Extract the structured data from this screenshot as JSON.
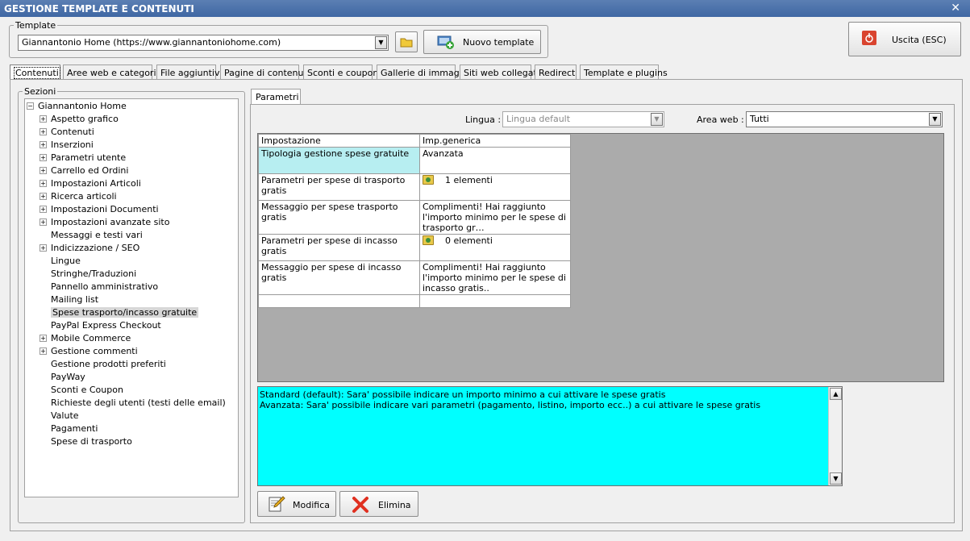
{
  "window": {
    "title": "GESTIONE TEMPLATE E CONTENUTI",
    "close_glyph": "✕"
  },
  "template": {
    "group_label": "Template",
    "selected": "Giannantonio Home (https://www.giannantoniohome.com)",
    "new_button": "Nuovo template"
  },
  "exit_button": "Uscita (ESC)",
  "tabs": [
    {
      "label": "Contenuti",
      "active": true
    },
    {
      "label": "Aree web e categorie"
    },
    {
      "label": "File aggiuntivi"
    },
    {
      "label": "Pagine di contenuti"
    },
    {
      "label": "Sconti e coupon"
    },
    {
      "label": "Gallerie di immagini"
    },
    {
      "label": "Siti web collegati"
    },
    {
      "label": "Redirect"
    },
    {
      "label": "Template e plugins"
    }
  ],
  "sections": {
    "label": "Sezioni",
    "root": "Giannantonio Home",
    "items": [
      {
        "label": "Aspetto grafico",
        "expandable": true
      },
      {
        "label": "Contenuti",
        "expandable": true
      },
      {
        "label": "Inserzioni",
        "expandable": true
      },
      {
        "label": "Parametri utente",
        "expandable": true
      },
      {
        "label": "Carrello ed Ordini",
        "expandable": true
      },
      {
        "label": "Impostazioni Articoli",
        "expandable": true
      },
      {
        "label": "Ricerca articoli",
        "expandable": true
      },
      {
        "label": "Impostazioni Documenti",
        "expandable": true
      },
      {
        "label": "Impostazioni avanzate sito",
        "expandable": true
      },
      {
        "label": "Messaggi e testi vari",
        "expandable": false
      },
      {
        "label": "Indicizzazione / SEO",
        "expandable": true
      },
      {
        "label": "Lingue",
        "expandable": false
      },
      {
        "label": "Stringhe/Traduzioni",
        "expandable": false
      },
      {
        "label": "Pannello amministrativo",
        "expandable": false
      },
      {
        "label": "Mailing list",
        "expandable": false
      },
      {
        "label": "Spese trasporto/incasso gratuite",
        "expandable": false,
        "selected": true
      },
      {
        "label": "PayPal Express Checkout",
        "expandable": false
      },
      {
        "label": "Mobile Commerce",
        "expandable": true
      },
      {
        "label": "Gestione commenti",
        "expandable": true
      },
      {
        "label": "Gestione prodotti preferiti",
        "expandable": false
      },
      {
        "label": "PayWay",
        "expandable": false
      },
      {
        "label": "Sconti e Coupon",
        "expandable": false
      },
      {
        "label": "Richieste degli utenti (testi delle email)",
        "expandable": false
      },
      {
        "label": "Valute",
        "expandable": false
      },
      {
        "label": "Pagamenti",
        "expandable": false
      },
      {
        "label": "Spese di trasporto",
        "expandable": false
      }
    ]
  },
  "parametri": {
    "tab_label": "Parametri",
    "lingua_label": "Lingua :",
    "lingua_value": "Lingua default",
    "area_label": "Area web :",
    "area_value": "Tutti",
    "columns": [
      "Impostazione",
      "Imp.generica"
    ],
    "rows": [
      {
        "setting": "Tipologia gestione spese gratuite",
        "value": "Avanzata",
        "folder": false,
        "highlight": true
      },
      {
        "setting": "Parametri per spese di trasporto gratis",
        "value": "1 elementi",
        "folder": true
      },
      {
        "setting": "Messaggio per spese trasporto gratis",
        "value": "Complimenti! Hai raggiunto l'importo minimo per le spese di trasporto gr…",
        "folder": false
      },
      {
        "setting": "Parametri per spese di incasso gratis",
        "value": "0 elementi",
        "folder": true
      },
      {
        "setting": "Messaggio per spese di incasso gratis",
        "value": "Complimenti! Hai raggiunto l'importo minimo per le spese di incasso gratis..",
        "folder": false
      },
      {
        "setting": "",
        "value": "",
        "folder": false
      }
    ],
    "description_lines": [
      "Standard (default): Sara' possibile indicare un importo minimo a cui attivare le spese gratis",
      "Avanzata: Sara' possibile indicare vari parametri (pagamento, listino, importo ecc..) a cui attivare le spese gratis"
    ],
    "modify_button": "Modifica",
    "delete_button": "Elimina"
  },
  "colors": {
    "description_bg": "#00ffff",
    "highlight_cell": "#b7eef1",
    "grid_bg": "#ababab",
    "titlebar": "#4a70a9"
  }
}
